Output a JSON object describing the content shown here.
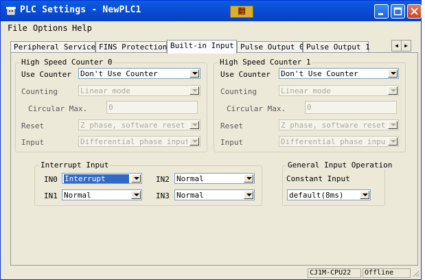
{
  "window": {
    "title": "PLC Settings - NewPLC1",
    "ime_indicator": "翻"
  },
  "menu": [
    "File",
    "Options",
    "Help"
  ],
  "tabs": [
    {
      "label": "Peripheral Service",
      "active": false
    },
    {
      "label": "FINS Protection",
      "active": false
    },
    {
      "label": "Built-in Input",
      "active": true
    },
    {
      "label": "Pulse Output 0",
      "active": false
    },
    {
      "label": "Pulse Output 1",
      "active": false
    }
  ],
  "hsc0": {
    "title": "High Speed Counter 0",
    "use_counter_label": "Use Counter",
    "use_counter_value": "Don't Use Counter",
    "counting_label": "Counting",
    "counting_value": "Linear mode",
    "circular_max_label": "Circular Max.",
    "circular_max_value": "0",
    "reset_label": "Reset",
    "reset_value": "Z phase, software reset",
    "input_label": "Input",
    "input_value": "Differential phase input"
  },
  "hsc1": {
    "title": "High Speed Counter 1",
    "use_counter_label": "Use Counter",
    "use_counter_value": "Don't Use Counter",
    "counting_label": "Counting",
    "counting_value": "Linear mode",
    "circular_max_label": "Circular Max.",
    "circular_max_value": "0",
    "reset_label": "Reset",
    "reset_value": "Z phase, software reset",
    "input_label": "Input",
    "input_value": "Differential phase input"
  },
  "interrupt": {
    "title": "Interrupt Input",
    "in0_label": "IN0",
    "in0_value": "Interrupt",
    "in1_label": "IN1",
    "in1_value": "Normal",
    "in2_label": "IN2",
    "in2_value": "Normal",
    "in3_label": "IN3",
    "in3_value": "Normal"
  },
  "general": {
    "title": "General Input Operation",
    "constant_label": "Constant Input",
    "constant_value": "default(8ms)"
  },
  "status": {
    "model": "CJ1M-CPU22",
    "connection": "Offline"
  }
}
